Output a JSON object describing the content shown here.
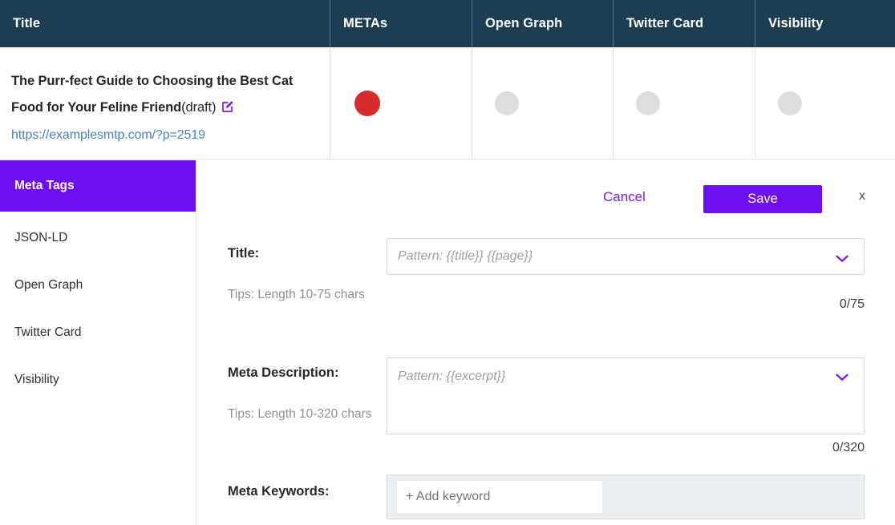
{
  "table": {
    "columns": [
      "Title",
      "METAs",
      "Open Graph",
      "Twitter Card",
      "Visibility"
    ],
    "row": {
      "title": "The Purr-fect Guide to Choosing the Best Cat Food for Your Feline Friend",
      "status": "(draft)",
      "edit_icon": "edit-square-icon",
      "url": "https://examplesmtp.com/?p=2519",
      "metas_status": "red",
      "open_graph_status": "grey",
      "twitter_card_status": "grey",
      "visibility_status": "grey"
    }
  },
  "sidebar": {
    "items": [
      {
        "label": "Meta Tags",
        "active": true
      },
      {
        "label": "JSON-LD",
        "active": false
      },
      {
        "label": "Open Graph",
        "active": false
      },
      {
        "label": "Twitter Card",
        "active": false
      },
      {
        "label": "Visibility",
        "active": false
      }
    ]
  },
  "actions": {
    "cancel_label": "Cancel",
    "save_label": "Save",
    "close_label": "x"
  },
  "form": {
    "title": {
      "label": "Title:",
      "tip": "Tips: Length 10-75 chars",
      "placeholder": "Pattern: {{title}} {{page}}",
      "value": "",
      "counter": "0/75",
      "chevron": "chevron-down-icon"
    },
    "meta_description": {
      "label": "Meta Description:",
      "tip": "Tips: Length 10-320 chars",
      "placeholder": "Pattern: {{excerpt}}",
      "value": "",
      "counter": "0/320",
      "chevron": "chevron-down-icon"
    },
    "meta_keywords": {
      "label": "Meta Keywords:",
      "placeholder": "+ Add keyword",
      "value": ""
    }
  },
  "colors": {
    "header_bg": "#1d3d52",
    "accent_purple": "#6d0ff0",
    "link_purple": "#7a18f0",
    "status_red": "#d82c2c",
    "status_grey": "#dedede",
    "url_blue": "#4b83ab"
  }
}
